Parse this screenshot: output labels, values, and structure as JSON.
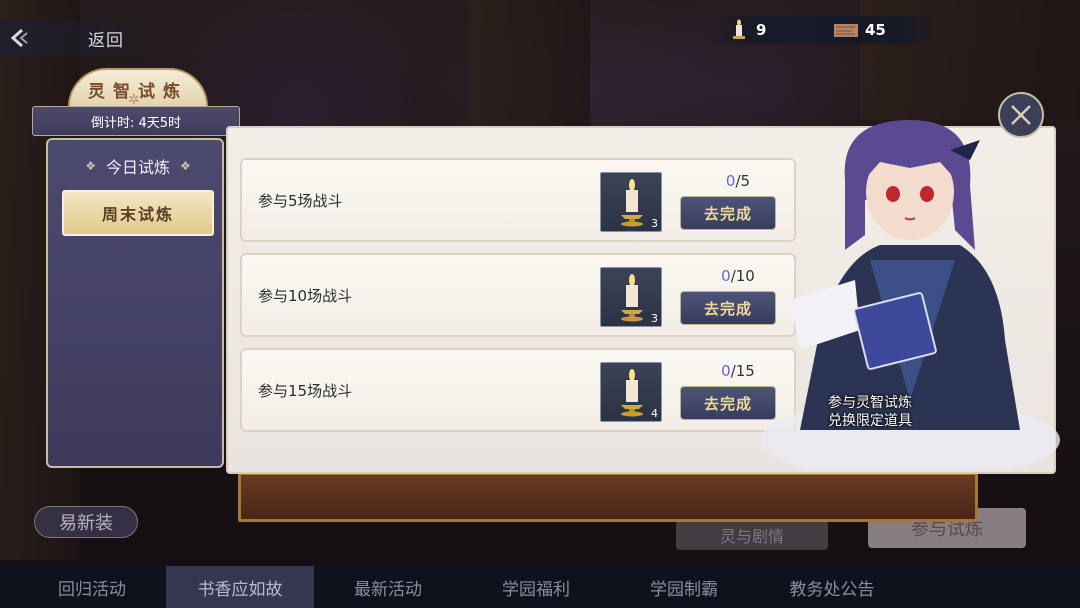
{
  "top_bar": {
    "back_label": "返回",
    "candle_count": "9",
    "paper_count": "45"
  },
  "left_panel": {
    "title": "灵智试炼",
    "countdown": "倒计时: 4天5时",
    "tabs": [
      {
        "label": "今日试炼",
        "active": false
      },
      {
        "label": "周末试炼",
        "active": true
      }
    ]
  },
  "tasks": [
    {
      "label": "参与5场战斗",
      "progress_current": "0",
      "progress_total": "/5",
      "reward_count": "3",
      "button": "去完成"
    },
    {
      "label": "参与10场战斗",
      "progress_current": "0",
      "progress_total": "/10",
      "reward_count": "3",
      "button": "去完成"
    },
    {
      "label": "参与15场战斗",
      "progress_current": "0",
      "progress_total": "/15",
      "reward_count": "4",
      "button": "去完成"
    }
  ],
  "character": {
    "caption_line1": "参与灵智试炼",
    "caption_line2": "兑换限定道具"
  },
  "background_buttons": {
    "outfit": "易新装",
    "join": "参与试炼",
    "plot": "灵与剧情"
  },
  "bottom_nav": [
    {
      "label": "回归活动",
      "active": false
    },
    {
      "label": "书香应如故",
      "active": true
    },
    {
      "label": "最新活动",
      "active": false
    },
    {
      "label": "学园福利",
      "active": false
    },
    {
      "label": "学园制霸",
      "active": false
    },
    {
      "label": "教务处公告",
      "active": false
    }
  ],
  "colors": {
    "accent_gold": "#f0d89a",
    "progress_current": "#6a63d8",
    "panel_purple": "#4c4a6e"
  }
}
